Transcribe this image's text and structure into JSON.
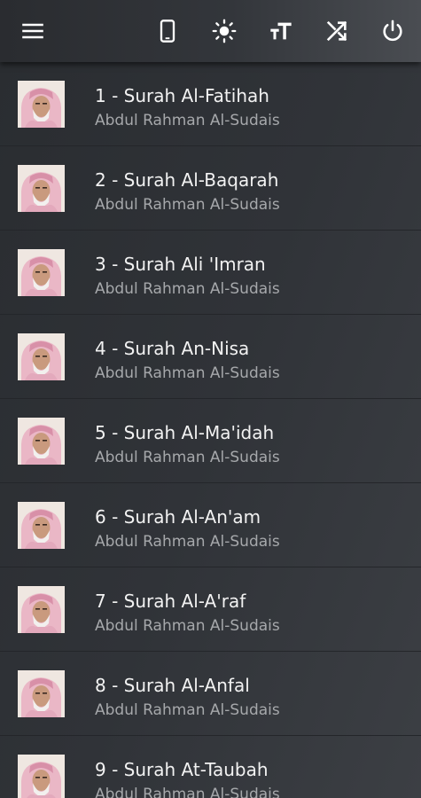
{
  "toolbar": {
    "icons": [
      {
        "name": "menu-icon"
      },
      {
        "name": "phone-icon"
      },
      {
        "name": "brightness-icon"
      },
      {
        "name": "text-size-icon"
      },
      {
        "name": "shuffle-icon"
      },
      {
        "name": "power-icon"
      }
    ],
    "icon_color": "#ffffff"
  },
  "tracks": [
    {
      "title": "1 - Surah Al-Fatihah",
      "reciter": "Abdul Rahman Al-Sudais"
    },
    {
      "title": "2 - Surah Al-Baqarah",
      "reciter": "Abdul Rahman Al-Sudais"
    },
    {
      "title": "3 - Surah Ali 'Imran",
      "reciter": "Abdul Rahman Al-Sudais"
    },
    {
      "title": "4 - Surah An-Nisa",
      "reciter": "Abdul Rahman Al-Sudais"
    },
    {
      "title": "5 - Surah Al-Ma'idah",
      "reciter": "Abdul Rahman Al-Sudais"
    },
    {
      "title": "6 - Surah Al-An'am",
      "reciter": "Abdul Rahman Al-Sudais"
    },
    {
      "title": "7 - Surah Al-A'raf",
      "reciter": "Abdul Rahman Al-Sudais"
    },
    {
      "title": "8 - Surah Al-Anfal",
      "reciter": "Abdul Rahman Al-Sudais"
    },
    {
      "title": "9 - Surah At-Taubah",
      "reciter": "Abdul Rahman Al-Sudais"
    }
  ],
  "colors": {
    "background": "#2c2f33",
    "title_text": "#f2f2f2",
    "subtitle_text": "#a6a8ab",
    "divider": "#24262a"
  }
}
